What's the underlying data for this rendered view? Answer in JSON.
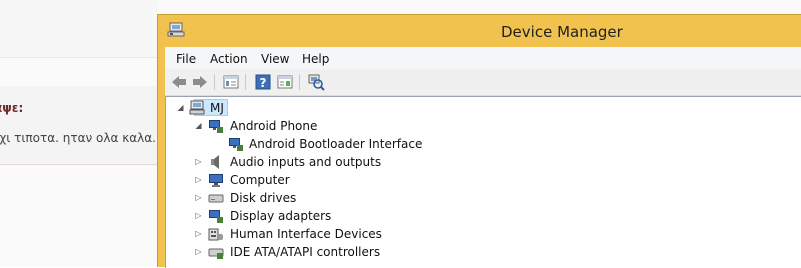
{
  "background_page": {
    "heading": "αψε:",
    "text": "οχι τιποτα. ηταν ολα καλα."
  },
  "window": {
    "title": "Device Manager",
    "title_icon": "device-manager-icon",
    "accent": "#f1c34e"
  },
  "menu": {
    "file": "File",
    "action": "Action",
    "view": "View",
    "help": "Help"
  },
  "toolbar": {
    "buttons": [
      "back-arrow-icon",
      "forward-arrow-icon",
      "properties-icon",
      "help-icon",
      "show-hide-icon",
      "scan-hardware-icon"
    ]
  },
  "tree": {
    "root": {
      "label": "MJ",
      "expanded": true,
      "selected": true,
      "icon": "computer-icon"
    },
    "items": [
      {
        "label": "Android Phone",
        "expanded": true,
        "icon": "android-device-icon"
      },
      {
        "label": "Android Bootloader Interface",
        "icon": "android-device-icon"
      },
      {
        "label": "Audio inputs and outputs",
        "expanded": false,
        "icon": "speaker-icon"
      },
      {
        "label": "Computer",
        "expanded": false,
        "icon": "monitor-icon"
      },
      {
        "label": "Disk drives",
        "expanded": false,
        "icon": "disk-drive-icon"
      },
      {
        "label": "Display adapters",
        "expanded": false,
        "icon": "display-adapter-icon"
      },
      {
        "label": "Human Interface Devices",
        "expanded": false,
        "icon": "hid-icon"
      },
      {
        "label": "IDE ATA/ATAPI controllers",
        "expanded": false,
        "icon": "ide-controller-icon"
      }
    ]
  }
}
